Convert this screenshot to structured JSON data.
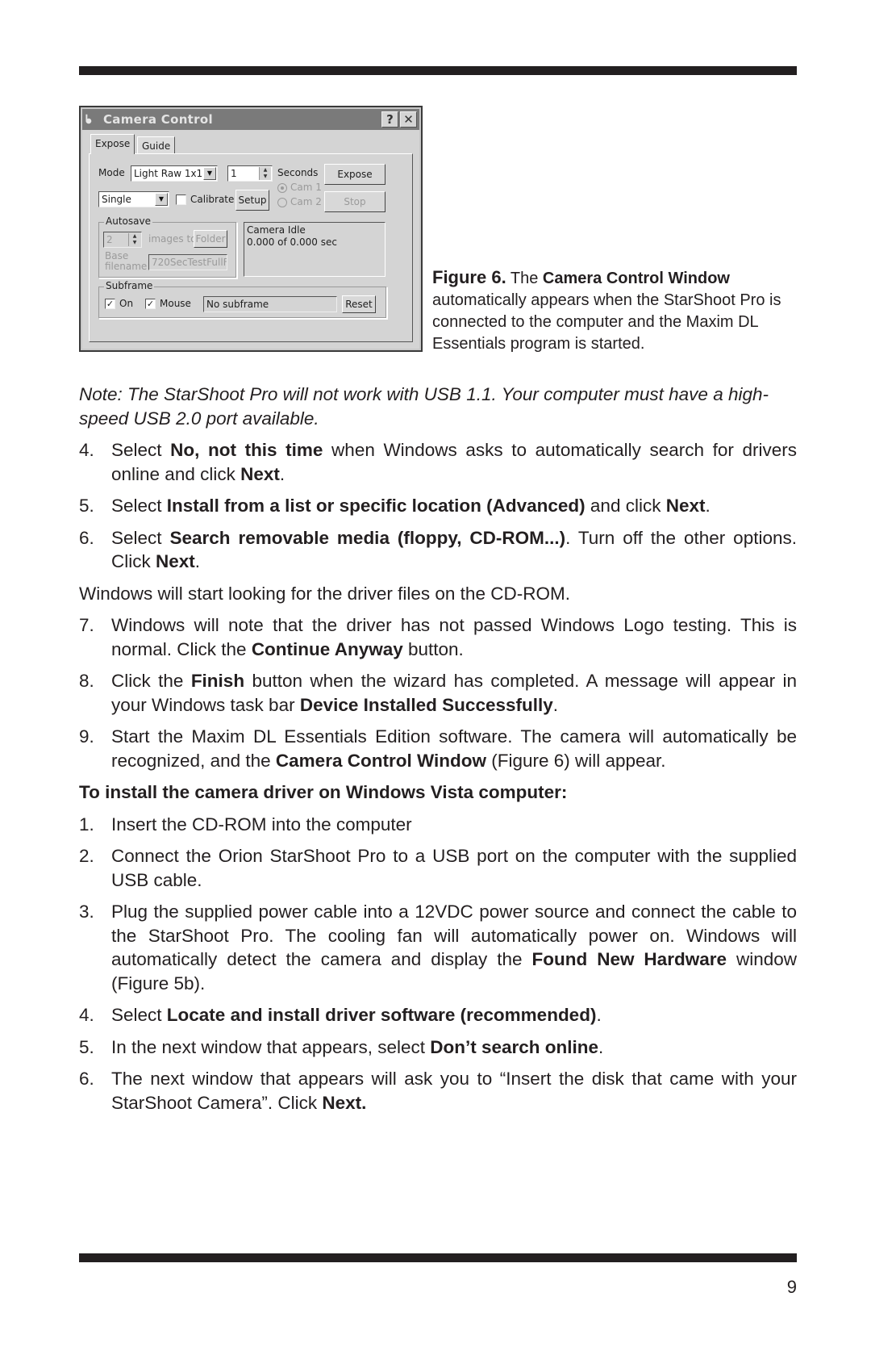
{
  "window": {
    "title": "Camera Control",
    "help_button": "?",
    "close_button": "✕",
    "tabs": [
      {
        "label": "Expose"
      },
      {
        "label": "Guide"
      }
    ],
    "mode_label": "Mode",
    "mode_value": "Light Raw 1x1",
    "seconds_value": "1",
    "seconds_label": "Seconds",
    "expose_button": "Expose",
    "sequence_value": "Single",
    "calibrate_label": "Calibrate",
    "setup_button": "Setup",
    "cam1_label": "Cam 1",
    "cam2_label": "Cam 2",
    "stop_button": "Stop",
    "autosave": {
      "group_label": "Autosave",
      "count_value": "2",
      "images_to_label": "images to",
      "folder_button": "Folder",
      "base_label_line1": "Base",
      "base_label_line2": "filename",
      "base_value": "720SecTestFullF"
    },
    "status": {
      "line1": "Camera Idle",
      "line2": "0.000 of 0.000 sec"
    },
    "subframe": {
      "group_label": "Subframe",
      "on_label": "On",
      "mouse_label": "Mouse",
      "value": "No subframe",
      "reset_button": "Reset"
    }
  },
  "caption": {
    "figure": "Figure 6.",
    "pre": "The",
    "bold": "Camera Control Window",
    "rest": "automatically appears when the StarShoot Pro is connected to the computer and the Maxim DL Essentials program is started."
  },
  "note": "Note: The StarShoot Pro will not work with USB 1.1. Your computer must have a high-speed USB 2.0 port available.",
  "xp_steps": [
    {
      "num": "4.",
      "a": "Select ",
      "b": "No, not this time",
      "c": " when Windows asks to automatically search for drivers online and click ",
      "d": "Next",
      "e": "."
    },
    {
      "num": "5.",
      "a": "Select ",
      "b": "Install from a list or specific location (Advanced)",
      "c": " and click ",
      "d": "Next",
      "e": "."
    },
    {
      "num": "6.",
      "a": "Select ",
      "b": "Search removable media (floppy, CD-ROM...)",
      "c": ". Turn off the other options. Click ",
      "d": "Next",
      "e": "."
    }
  ],
  "windows_looking": "Windows will start looking for the driver files on the CD-ROM.",
  "xp_steps2": [
    {
      "num": "7.",
      "a": "Windows will note that the driver has not passed Windows Logo testing. This is normal. Click the ",
      "b": "Continue Anyway",
      "c": " button.",
      "d": "",
      "e": ""
    },
    {
      "num": "8.",
      "a": "Click the ",
      "b": "Finish",
      "c": " button when the wizard has completed. A message will appear in your Windows task bar ",
      "d": "Device Installed Successfully",
      "e": "."
    },
    {
      "num": "9.",
      "a": "Start the Maxim DL Essentials Edition software. The camera will automatically be recognized, and the ",
      "b": "Camera Control Window",
      "c": " (Figure 6) will appear.",
      "d": "",
      "e": ""
    }
  ],
  "vista_heading": "To install the camera driver on Windows Vista computer:",
  "vista_steps": [
    {
      "num": "1.",
      "a": "Insert the CD-ROM into the computer",
      "b": "",
      "c": "",
      "d": "",
      "e": ""
    },
    {
      "num": "2.",
      "a": "Connect the Orion StarShoot Pro to a USB port on the computer with the supplied USB cable.",
      "b": "",
      "c": "",
      "d": "",
      "e": ""
    },
    {
      "num": "3.",
      "a": "Plug the supplied power cable into a 12VDC power source and connect the cable to the StarShoot Pro. The cooling fan will automatically power on. Windows will automatically detect the camera and display the ",
      "b": "Found New Hardware",
      "c": " window (Figure 5b).",
      "d": "",
      "e": ""
    },
    {
      "num": "4.",
      "a": "Select ",
      "b": "Locate and install driver software (recommended)",
      "c": ".",
      "d": "",
      "e": ""
    },
    {
      "num": "5.",
      "a": "In the next window that appears, select ",
      "b": "Don’t search online",
      "c": ".",
      "d": "",
      "e": ""
    },
    {
      "num": "6.",
      "a": "The next window that appears will ask you to “Insert the disk that came with your StarShoot Camera”. Click ",
      "b": "Next.",
      "c": "",
      "d": "",
      "e": ""
    }
  ],
  "page_number": "9"
}
